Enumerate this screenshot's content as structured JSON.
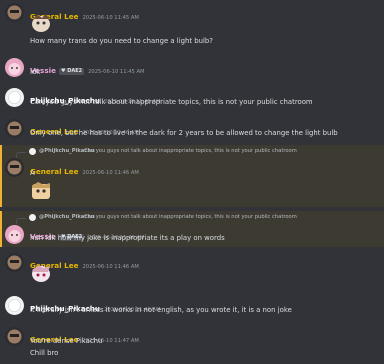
{
  "colors": {
    "background": "#313338",
    "mention_highlight": "#3d3a31",
    "mention_bar": "#f0b232",
    "general_lee": "#e6b800",
    "vessie": "#e8a0d8",
    "phijkchu": "#ffffff"
  },
  "messages": [
    {
      "author": "General Lee",
      "time": "2025-06-10 11:45 AM",
      "text": "How many trans do you need to change a light bulb?"
    },
    {
      "author": "Vessie",
      "tag": "DAE2",
      "time": "2025-06-10 11:45 AM",
      "text": "idk"
    },
    {
      "author": "Phijkchu_Pikachu",
      "time": "2025-06-10 11:45 AM",
      "text": "Can you guys not talk about inappropriate topics, this is not your public chatroom"
    },
    {
      "author": "General Lee",
      "time": "2025-06-10 11:46 AM",
      "text": "Only one, but he has to live in the dark for 2 years to be allowed to change the light bulb"
    },
    {
      "reply_author": "@Phijkchu_Pikachu",
      "reply_text": "Can you guys not talk about inappropriate topics, this is not your public chatroom",
      "author": "General Lee",
      "time": "2025-06-10 11:46 AM",
      "text": "A"
    },
    {
      "reply_author": "@Phijkchu_Pikachu",
      "reply_text": "Can you guys not talk about inappropriate topics, this is not your public chatroom",
      "author": "Vessie",
      "tag": "DAE2",
      "time": "2025-06-10 11:46 AM",
      "text": "huh idk how my joke is inappropriate its a play on words"
    },
    {
      "author": "General Lee",
      "time": "2025-06-10 11:46 AM"
    },
    {
      "author": "Phijkchu_Pikachu",
      "time": "2025-06-10 11:46 AM",
      "text": "It literally isn't unless it works in not english, as you wrote it, it is a non joke"
    },
    {
      "author": "General Lee",
      "time": "2025-06-10 11:47 AM",
      "text": "You're dense Pikachu",
      "text2": "Chill bro"
    }
  ]
}
